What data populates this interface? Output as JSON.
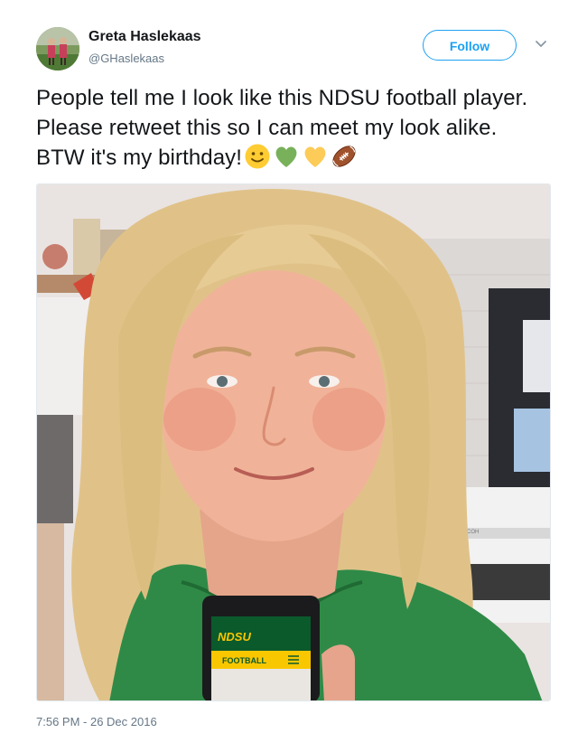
{
  "user": {
    "name": "Greta Haslekaas",
    "handle": "@GHaslekaas"
  },
  "follow_button": {
    "label": "Follow"
  },
  "tweet": {
    "text": "People tell me I look like this NDSU football player. Please retweet this so I can meet my look alike. BTW it's my birthday!",
    "emojis": [
      "slightly-smiling-face",
      "green-heart",
      "yellow-heart",
      "american-football"
    ]
  },
  "photo": {
    "phone_screen": {
      "logo_text": "NDSU",
      "menu_label": "FOOTBALL"
    },
    "printer_brand": "RICOH"
  },
  "timestamp": "7:56 PM - 26 Dec 2016",
  "colors": {
    "accent": "#1da1f2",
    "text": "#14171a",
    "muted": "#657786",
    "ndsu_green": "#0b5a2c",
    "ndsu_yellow": "#f9c700"
  }
}
